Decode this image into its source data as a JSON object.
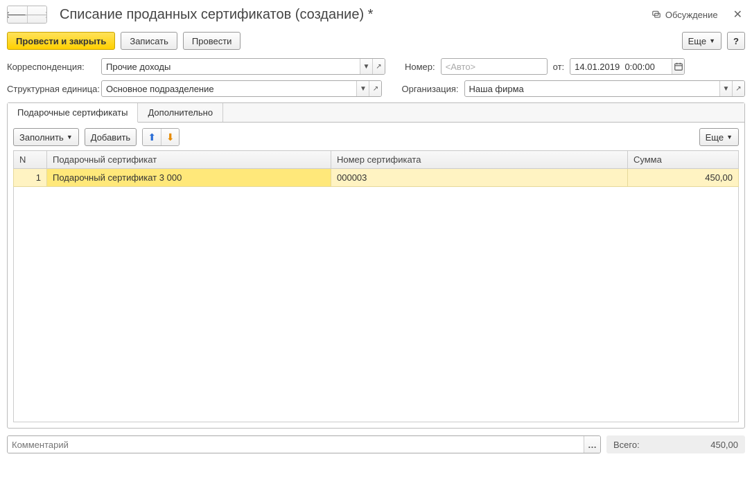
{
  "header": {
    "title": "Списание проданных сертификатов (создание) *",
    "discussion": "Обсуждение"
  },
  "toolbar": {
    "post_and_close": "Провести и закрыть",
    "save": "Записать",
    "post": "Провести",
    "more": "Еще",
    "help": "?"
  },
  "form": {
    "correspondence_label": "Корреспонденция:",
    "correspondence_value": "Прочие доходы",
    "number_label": "Номер:",
    "number_placeholder": "<Авто>",
    "from_label": "от:",
    "date_value": "14.01.2019  0:00:00",
    "unit_label": "Структурная единица:",
    "unit_value": "Основное подразделение",
    "org_label": "Организация:",
    "org_value": "Наша фирма"
  },
  "tabs": [
    {
      "label": "Подарочные сертификаты",
      "active": true
    },
    {
      "label": "Дополнительно",
      "active": false
    }
  ],
  "subtoolbar": {
    "fill": "Заполнить",
    "add": "Добавить",
    "more": "Еще"
  },
  "grid": {
    "columns": {
      "n": "N",
      "cert": "Подарочный сертификат",
      "num": "Номер сертификата",
      "sum": "Сумма"
    },
    "rows": [
      {
        "n": "1",
        "cert": "Подарочный сертификат 3 000",
        "num": "000003",
        "sum": "450,00"
      }
    ]
  },
  "footer": {
    "comment_placeholder": "Комментарий",
    "total_label": "Всего:",
    "total_value": "450,00"
  }
}
